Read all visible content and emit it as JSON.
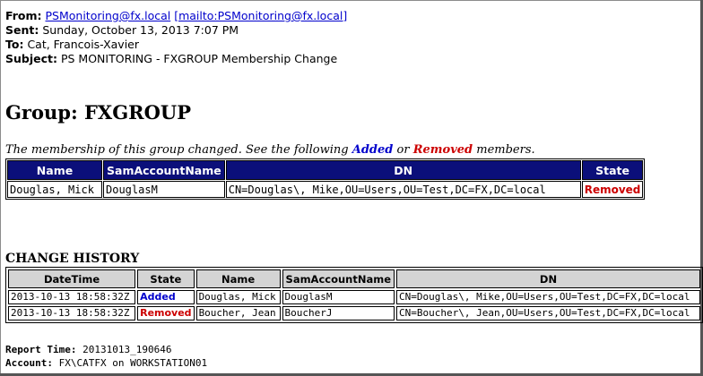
{
  "header": {
    "from_label": "From:",
    "from_email": "PSMonitoring@fx.local",
    "from_mailto": "[mailto:PSMonitoring@fx.local]",
    "sent_label": "Sent:",
    "sent_value": "Sunday, October 13, 2013 7:07 PM",
    "to_label": "To:",
    "to_value": "Cat, Francois-Xavier",
    "subject_label": "Subject:",
    "subject_value": "PS MONITORING - FXGROUP Membership Change"
  },
  "group_title": "Group: FXGROUP",
  "intro": {
    "prefix": "The membership of this group changed. See the following ",
    "added": "Added",
    "or": " or ",
    "removed": "Removed",
    "suffix": " members."
  },
  "membership_table": {
    "headers": [
      "Name",
      "SamAccountName",
      "DN",
      "State"
    ],
    "rows": [
      {
        "name": "Douglas, Mick",
        "sam": "DouglasM",
        "dn": "CN=Douglas\\, Mike,OU=Users,OU=Test,DC=FX,DC=local",
        "state": "Removed"
      }
    ]
  },
  "history_title": "CHANGE HISTORY",
  "history_table": {
    "headers": [
      "DateTime",
      "State",
      "Name",
      "SamAccountName",
      "DN"
    ],
    "rows": [
      {
        "datetime": "2013-10-13 18:58:32Z",
        "state": "Added",
        "name": "Douglas, Mick",
        "sam": "DouglasM",
        "dn": "CN=Douglas\\, Mike,OU=Users,OU=Test,DC=FX,DC=local"
      },
      {
        "datetime": "2013-10-13 18:58:32Z",
        "state": "Removed",
        "name": "Boucher, Jean",
        "sam": "BoucherJ",
        "dn": "CN=Boucher\\, Jean,OU=Users,OU=Test,DC=FX,DC=local"
      }
    ]
  },
  "footer": {
    "report_time_label": "Report Time:",
    "report_time_value": "20131013_190646",
    "account_label": "Account:",
    "account_value": "FX\\CATFX on WORKSTATION01"
  },
  "colors": {
    "header_bg": "#0b0f7a",
    "history_header_bg": "#d4d4d4",
    "added": "#0000cc",
    "removed": "#cc0000",
    "link": "#0000cc"
  }
}
